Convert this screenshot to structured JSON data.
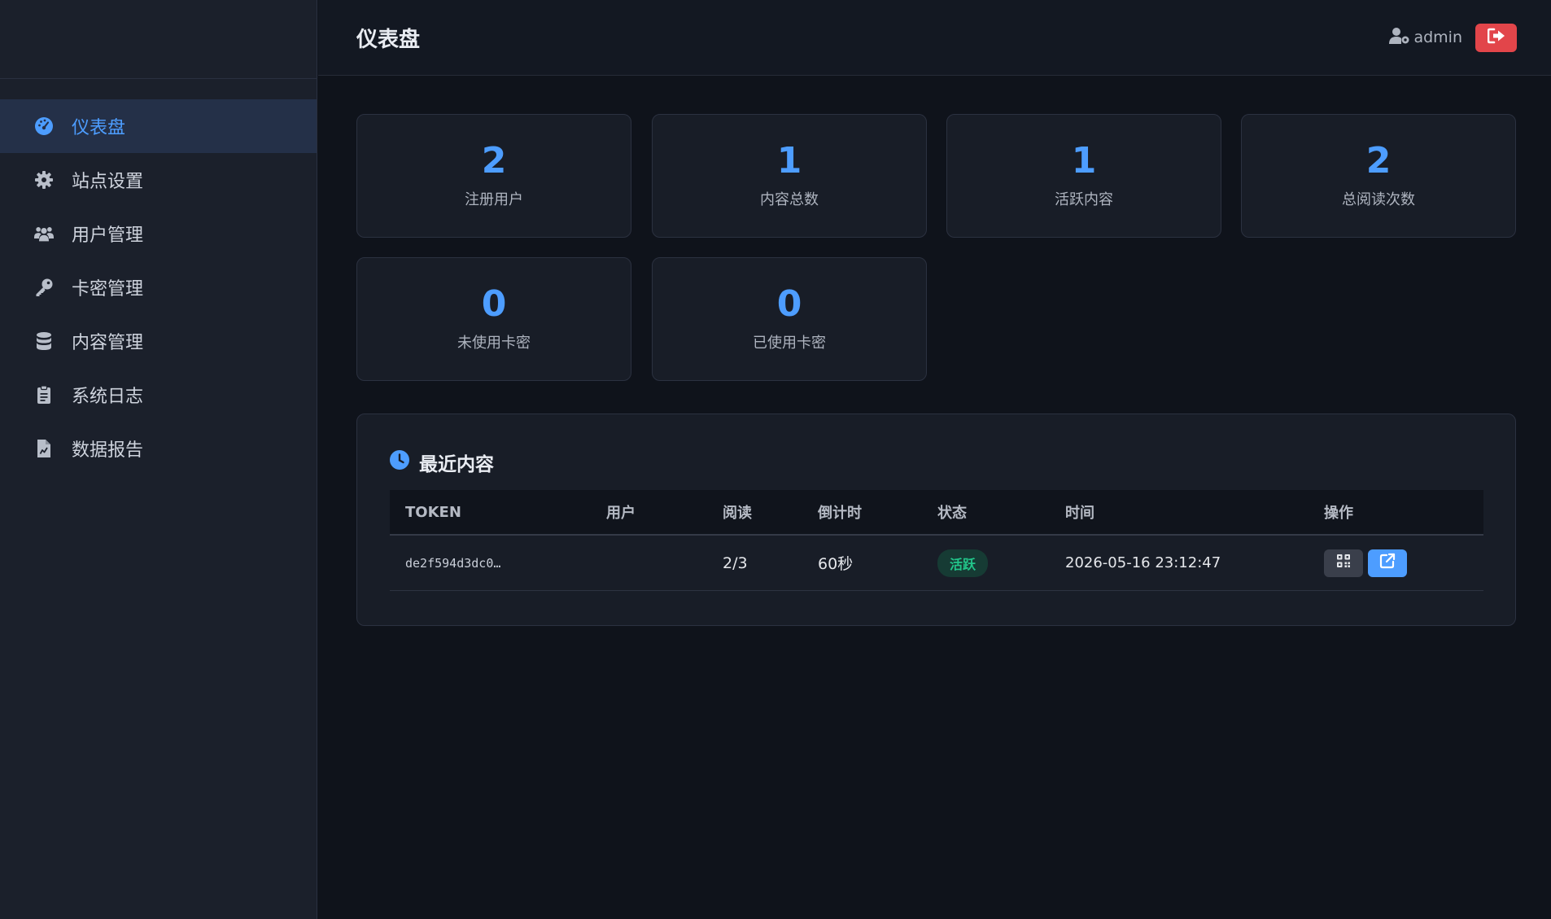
{
  "header": {
    "title": "仪表盘",
    "username": "admin"
  },
  "sidebar": {
    "items": [
      {
        "label": "仪表盘",
        "icon": "dashboard-icon",
        "active": true
      },
      {
        "label": "站点设置",
        "icon": "gear-icon"
      },
      {
        "label": "用户管理",
        "icon": "users-icon"
      },
      {
        "label": "卡密管理",
        "icon": "key-icon"
      },
      {
        "label": "内容管理",
        "icon": "database-icon"
      },
      {
        "label": "系统日志",
        "icon": "clipboard-icon"
      },
      {
        "label": "数据报告",
        "icon": "file-chart-icon"
      }
    ]
  },
  "stats": [
    {
      "value": "2",
      "label": "注册用户"
    },
    {
      "value": "1",
      "label": "内容总数"
    },
    {
      "value": "1",
      "label": "活跃内容"
    },
    {
      "value": "2",
      "label": "总阅读次数"
    },
    {
      "value": "0",
      "label": "未使用卡密"
    },
    {
      "value": "0",
      "label": "已使用卡密"
    }
  ],
  "recent": {
    "title": "最近内容",
    "columns": [
      "TOKEN",
      "用户",
      "阅读",
      "倒计时",
      "状态",
      "时间",
      "操作"
    ],
    "rows": [
      {
        "token": "de2f594d3dc0…",
        "user": "",
        "reads": "2/3",
        "countdown": "60秒",
        "status": "活跃",
        "time": "2026-05-16 23:12:47"
      }
    ]
  },
  "colors": {
    "accent": "#4d9dff",
    "danger": "#e2454a",
    "success": "#22c58a",
    "background": "#0f131b",
    "sidebar": "#1b202b"
  }
}
